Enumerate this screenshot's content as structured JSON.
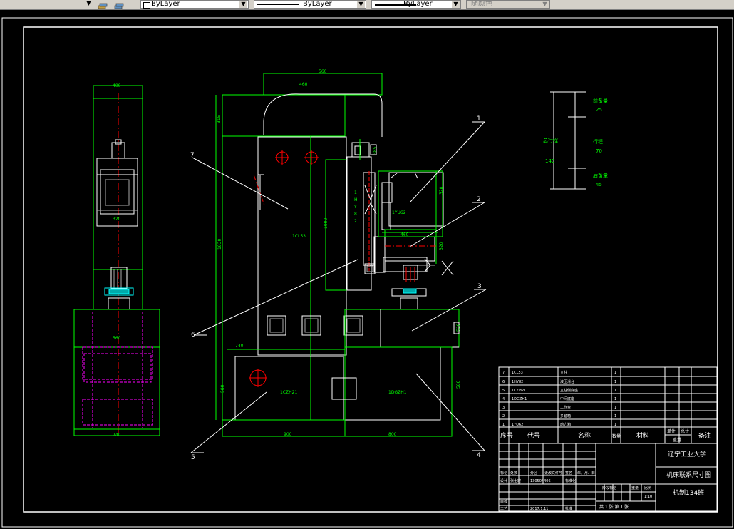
{
  "toolbar": {
    "color_label": "ByLayer",
    "linetype_label": "ByLayer",
    "lineweight_label": "ByLayer",
    "plotstyle_label": "随颜色"
  },
  "dims": {
    "top_width": "560",
    "inner_width": "460",
    "left_col_width": "400",
    "height_total": "1830",
    "top_height": "315",
    "head_dim": "385",
    "inner_height": "1000",
    "stroke_dim": "320",
    "cyl_h": "320",
    "cyl_w": "460",
    "left_lower": "560",
    "width_740_mid": "740",
    "width_740_left": "740",
    "left_bottom_width": "560",
    "base_height": "580",
    "mid_height": "530",
    "right_height": "580",
    "base_width_left": "900",
    "base_width_right": "800",
    "left_320": "320"
  },
  "parts_labels": {
    "p7": "1CL53",
    "p_cyl": "1YU62",
    "p_pump": "1CZH21",
    "p_base": "1DGZH1",
    "vertical_text": [
      "1",
      "H",
      "Y",
      "8",
      "2"
    ]
  },
  "callouts": [
    "1",
    "2",
    "3",
    "4",
    "5",
    "6",
    "7"
  ],
  "stroke_diagram": {
    "total_label": "总行程",
    "total_value": "140",
    "front_label": "前备量",
    "front_value": "25",
    "stroke_label": "行程",
    "stroke_value": "70",
    "rear_label": "后备量",
    "rear_value": "45"
  },
  "bom": {
    "rows": [
      {
        "no": "7",
        "code": "1CL53",
        "name": "立柱",
        "qty": "1"
      },
      {
        "no": "6",
        "code": "1HY82",
        "name": "液压滑台",
        "qty": "1"
      },
      {
        "no": "5",
        "code": "1CZH21",
        "name": "立柱侧底座",
        "qty": "1"
      },
      {
        "no": "4",
        "code": "1DGZH1",
        "name": "中间底座",
        "qty": "1"
      },
      {
        "no": "3",
        "code": "",
        "name": "工作台",
        "qty": "1"
      },
      {
        "no": "2",
        "code": "",
        "name": "多轴箱",
        "qty": "1"
      },
      {
        "no": "1",
        "code": "1YU62",
        "name": "动力箱",
        "qty": "1"
      }
    ],
    "header": {
      "no": "序号",
      "code": "代号",
      "name": "名称",
      "qty": "数量",
      "material": "材料",
      "single": "单件",
      "total": "总计",
      "weight": "重量",
      "remark": "备注"
    }
  },
  "title_block": {
    "school": "辽宁工业大学",
    "drawing_title": "机床联系尺寸图",
    "drawing_no": "机制134班",
    "scale": "1:10",
    "stage_label": "阶段标记",
    "weight_label": "重量",
    "scale_label": "比例",
    "sheet_text": "共  1  张     第  1  张",
    "row_labels": {
      "mark": "标记",
      "count": "处数",
      "zone": "分区",
      "change_no": "更改文件号",
      "sign": "签名",
      "date": "年、月、日",
      "design": "设计",
      "designer": "张士宏",
      "design_date": "130504406",
      "standardize": "标准化",
      "review": "审核",
      "process": "工艺",
      "approve": "批准",
      "approve_date": "2017.1.11"
    }
  }
}
